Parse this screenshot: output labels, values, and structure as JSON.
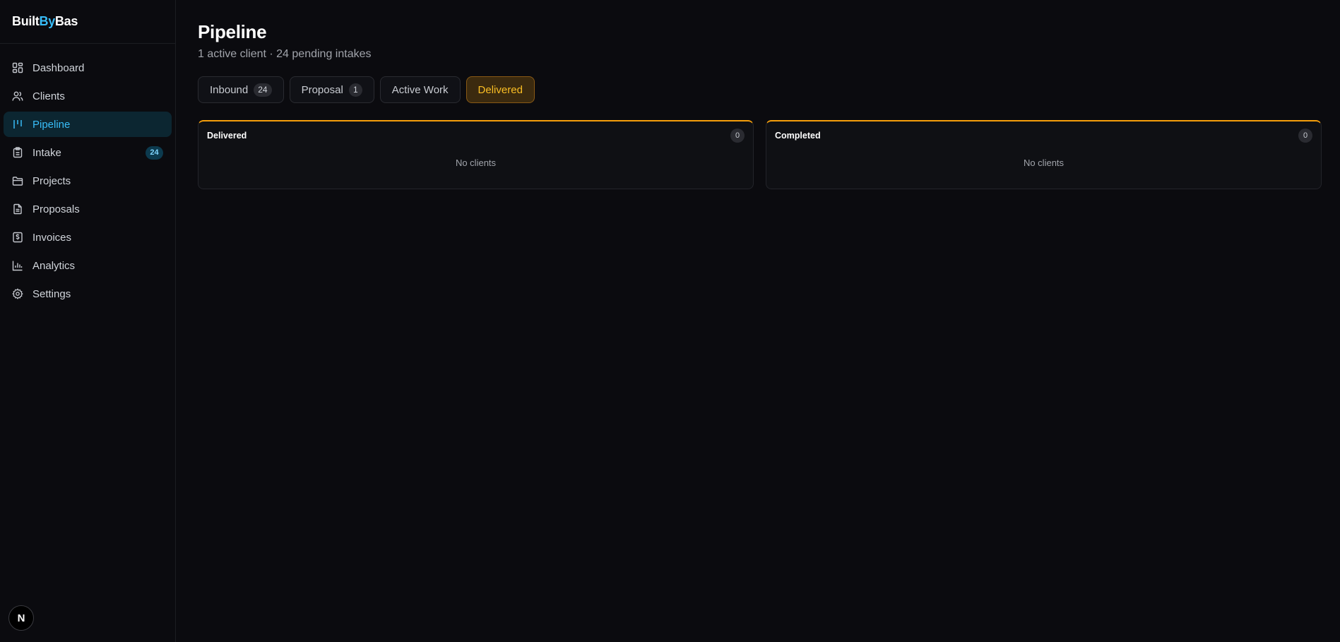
{
  "brand": {
    "part1": "Built",
    "part2": "By",
    "part3": "Bas"
  },
  "sidebar": {
    "items": [
      {
        "label": "Dashboard",
        "icon": "dashboard-icon"
      },
      {
        "label": "Clients",
        "icon": "users-icon"
      },
      {
        "label": "Pipeline",
        "icon": "kanban-icon",
        "active": true
      },
      {
        "label": "Intake",
        "icon": "clipboard-icon",
        "badge": "24"
      },
      {
        "label": "Projects",
        "icon": "folder-icon"
      },
      {
        "label": "Proposals",
        "icon": "file-text-icon"
      },
      {
        "label": "Invoices",
        "icon": "dollar-receipt-icon"
      },
      {
        "label": "Analytics",
        "icon": "bar-chart-icon"
      },
      {
        "label": "Settings",
        "icon": "gear-icon"
      }
    ],
    "footer_badge": "N"
  },
  "page": {
    "title": "Pipeline",
    "subtitle": "1 active client · 24 pending intakes"
  },
  "tabs": [
    {
      "label": "Inbound",
      "count": "24"
    },
    {
      "label": "Proposal",
      "count": "1"
    },
    {
      "label": "Active Work"
    },
    {
      "label": "Delivered",
      "active": true
    }
  ],
  "columns": [
    {
      "title": "Delivered",
      "count": "0",
      "empty_text": "No clients"
    },
    {
      "title": "Completed",
      "count": "0",
      "empty_text": "No clients"
    }
  ],
  "colors": {
    "accent_blue": "#38bdf8",
    "accent_amber": "#f59e0b",
    "background": "#0b0b0f"
  }
}
